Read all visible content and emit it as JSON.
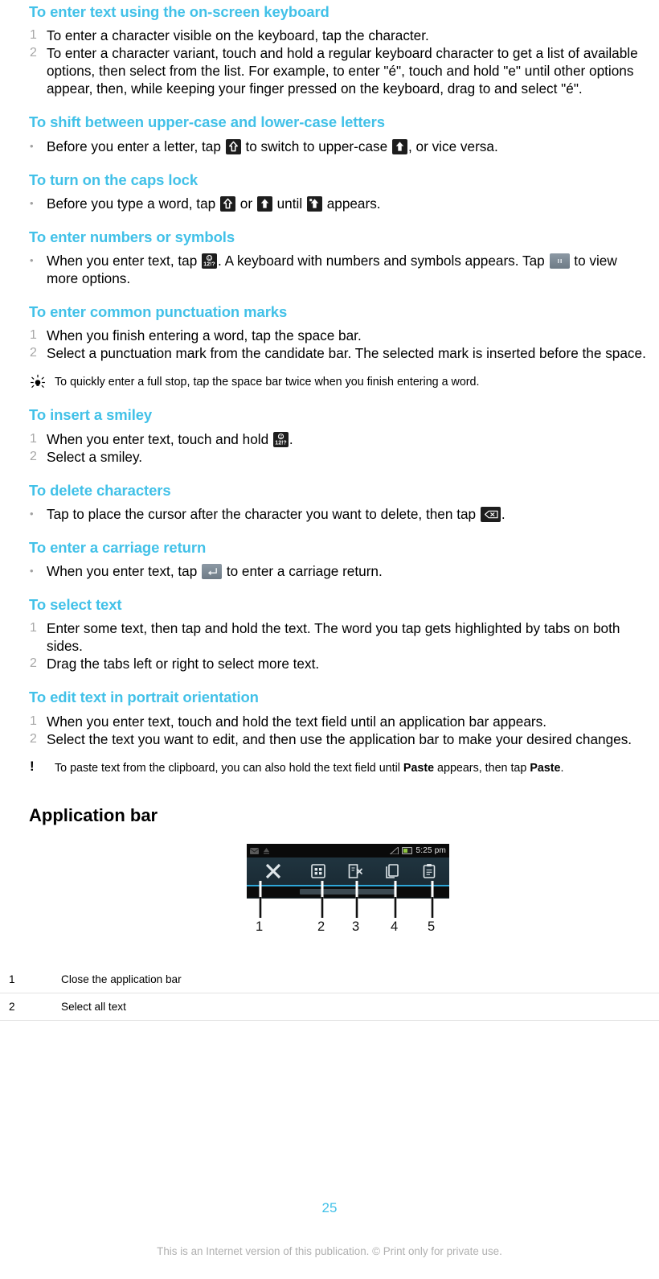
{
  "document": {
    "page_number": "25",
    "footnote": "This is an Internet version of this publication. © Print only for private use.",
    "accent_color": "#42c1e8",
    "marker_color": "#a7a7a7"
  },
  "sections": [
    {
      "heading": "To enter text using the on-screen keyboard",
      "steps": [
        {
          "marker": "1",
          "text": "To enter a character visible on the keyboard, tap the character."
        },
        {
          "marker": "2",
          "text": "To enter a character variant, touch and hold a regular keyboard character to get a list of available options, then select from the list. For example, to enter \"é\", touch and hold \"e\" until other options appear, then, while keeping your finger pressed on the keyboard, drag to and select \"é\"."
        }
      ]
    },
    {
      "heading": "To shift between upper-case and lower-case letters",
      "steps": [
        {
          "marker": "•",
          "text_parts": [
            "Before you enter a letter, tap ",
            " to switch to upper-case ",
            ", or vice versa."
          ],
          "icons": [
            "shift-outline-icon",
            "shift-filled-icon"
          ]
        }
      ]
    },
    {
      "heading": "To turn on the caps lock",
      "steps": [
        {
          "marker": "•",
          "text_parts": [
            "Before you type a word, tap ",
            " or ",
            " until ",
            " appears."
          ],
          "icons": [
            "shift-outline-icon",
            "shift-filled-icon",
            "caps-lock-icon"
          ]
        }
      ]
    },
    {
      "heading": "To enter numbers or symbols",
      "steps": [
        {
          "marker": "•",
          "text_parts": [
            "When you enter text, tap ",
            ". A keyboard with numbers and symbols appears. Tap ",
            " to view more options."
          ],
          "icons": [
            "numbers-symbols-key-icon",
            "more-options-key-icon"
          ]
        }
      ]
    },
    {
      "heading": "To enter common punctuation marks",
      "steps": [
        {
          "marker": "1",
          "text": "When you finish entering a word, tap the space bar."
        },
        {
          "marker": "2",
          "text": "Select a punctuation mark from the candidate bar. The selected mark is inserted before the space."
        }
      ],
      "tip": {
        "icon": "lightbulb-icon",
        "text": "To quickly enter a full stop, tap the space bar twice when you finish entering a word."
      }
    },
    {
      "heading": "To insert a smiley",
      "steps": [
        {
          "marker": "1",
          "text_parts": [
            "When you enter text, touch and hold ",
            "."
          ],
          "icons": [
            "numbers-symbols-key-icon"
          ]
        },
        {
          "marker": "2",
          "text": "Select a smiley."
        }
      ]
    },
    {
      "heading": "To delete characters",
      "steps": [
        {
          "marker": "•",
          "text_parts": [
            "Tap to place the cursor after the character you want to delete, then tap ",
            "."
          ],
          "icons": [
            "backspace-key-icon"
          ]
        }
      ]
    },
    {
      "heading": "To enter a carriage return",
      "steps": [
        {
          "marker": "•",
          "text_parts": [
            "When you enter text, tap ",
            " to enter a carriage return."
          ],
          "icons": [
            "return-key-icon"
          ]
        }
      ]
    },
    {
      "heading": "To select text",
      "steps": [
        {
          "marker": "1",
          "text": "Enter some text, then tap and hold the text. The word you tap gets highlighted by tabs on both sides."
        },
        {
          "marker": "2",
          "text": "Drag the tabs left or right to select more text."
        }
      ]
    },
    {
      "heading": "To edit text in portrait orientation",
      "steps": [
        {
          "marker": "1",
          "text": "When you enter text, touch and hold the text field until an application bar appears."
        },
        {
          "marker": "2",
          "text": "Select the text you want to edit, and then use the application bar to make your desired changes."
        }
      ],
      "note": {
        "icon": "exclamation-icon",
        "text_before": "To paste text from the clipboard, you can also hold the text field until ",
        "bold_1": "Paste",
        "text_middle": " appears, then tap ",
        "bold_2": "Paste",
        "text_after": "."
      }
    }
  ],
  "application_bar": {
    "title": "Application bar",
    "screenshot": {
      "status_bar": {
        "time": "5:25 pm",
        "left_icons": [
          "message-icon",
          "upload-icon"
        ],
        "right_icons": [
          "signal-icon",
          "battery-icon"
        ]
      },
      "toolbar_icons": [
        {
          "number": "1",
          "name": "close-icon"
        },
        {
          "number": "2",
          "name": "select-all-icon"
        },
        {
          "number": "3",
          "name": "cut-icon"
        },
        {
          "number": "4",
          "name": "copy-icon"
        },
        {
          "number": "5",
          "name": "paste-icon"
        }
      ]
    },
    "callout_numbers": [
      "1",
      "2",
      "3",
      "4",
      "5"
    ],
    "legend": [
      {
        "num": "1",
        "label": "Close the application bar"
      },
      {
        "num": "2",
        "label": "Select all text"
      }
    ]
  }
}
